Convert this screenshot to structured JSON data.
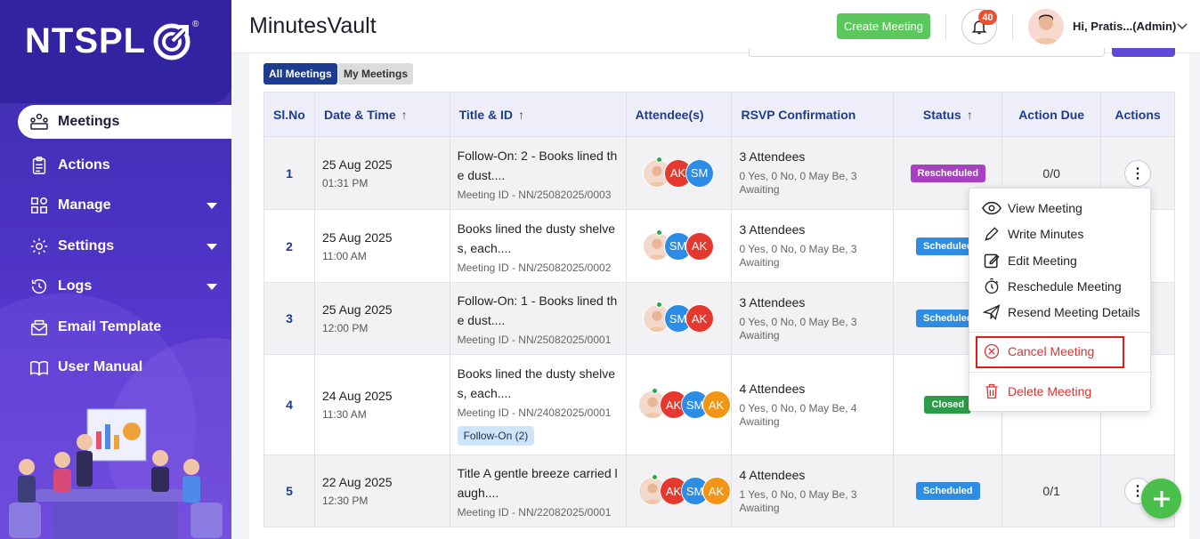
{
  "brand": {
    "logo_text": "NTSPL",
    "reg": "®"
  },
  "sidebar": {
    "items": [
      {
        "label": "Meetings",
        "icon": "meetings-icon",
        "active": true,
        "has_caret": false
      },
      {
        "label": "Actions",
        "icon": "clipboard-icon",
        "has_caret": false
      },
      {
        "label": "Manage",
        "icon": "grid-icon",
        "has_caret": true
      },
      {
        "label": "Settings",
        "icon": "gear-icon",
        "has_caret": true
      },
      {
        "label": "Logs",
        "icon": "history-icon",
        "has_caret": true
      },
      {
        "label": "Email Template",
        "icon": "email-icon",
        "has_caret": false
      },
      {
        "label": "User Manual",
        "icon": "book-icon",
        "has_caret": false
      }
    ]
  },
  "header": {
    "title": "MinutesVault",
    "create_label": "Create Meeting",
    "notification_count": "40",
    "user_label": "Hi, Pratis...(Admin)"
  },
  "tabs": {
    "all": "All Meetings",
    "my": "My Meetings"
  },
  "table": {
    "headers": {
      "sl": "Sl.No",
      "date": "Date & Time",
      "title": "Title & ID",
      "attendees": "Attendee(s)",
      "rsvp": "RSVP Confirmation",
      "status": "Status",
      "due": "Action Due",
      "actions": "Actions"
    },
    "rows": [
      {
        "sl": "1",
        "date": "25 Aug 2025",
        "time": "01:31 PM",
        "title": "Follow-On: 2 - Books lined the dust....",
        "id": "Meeting ID - NN/25082025/0003",
        "followon": "",
        "avatars": [
          "AK",
          "SM"
        ],
        "rsvp_main": "3 Attendees",
        "rsvp_sub": "0 Yes, 0 No, 0 May Be, 3 Awaiting",
        "status": "Rescheduled",
        "due": "0/0"
      },
      {
        "sl": "2",
        "date": "25 Aug 2025",
        "time": "11:00 AM",
        "title": "Books lined the dusty shelves, each....",
        "id": "Meeting ID - NN/25082025/0002",
        "followon": "",
        "avatars": [
          "SM",
          "AK"
        ],
        "rsvp_main": "3 Attendees",
        "rsvp_sub": "0 Yes, 0 No, 0 May Be, 3 Awaiting",
        "status": "Scheduled",
        "due": ""
      },
      {
        "sl": "3",
        "date": "25 Aug 2025",
        "time": "12:00 PM",
        "title": "Follow-On: 1 - Books lined the dust....",
        "id": "Meeting ID - NN/25082025/0001",
        "followon": "",
        "avatars": [
          "SM",
          "AK"
        ],
        "rsvp_main": "3 Attendees",
        "rsvp_sub": "0 Yes, 0 No, 0 May Be, 3 Awaiting",
        "status": "Scheduled",
        "due": ""
      },
      {
        "sl": "4",
        "date": "24 Aug 2025",
        "time": "11:30 AM",
        "title": "Books lined the dusty shelves, each....",
        "id": "Meeting ID - NN/24082025/0001",
        "followon": "Follow-On (2)",
        "avatars": [
          "AK",
          "SM",
          "AK"
        ],
        "rsvp_main": "4 Attendees",
        "rsvp_sub": "0 Yes, 0 No, 0 May Be, 4 Awaiting",
        "status": "Closed",
        "due": ""
      },
      {
        "sl": "5",
        "date": "22 Aug 2025",
        "time": "12:30 PM",
        "title": "Title A gentle breeze carried laugh....",
        "id": "Meeting ID - NN/22082025/0001",
        "followon": "",
        "avatars": [
          "AK",
          "SM",
          "AK"
        ],
        "rsvp_main": "4 Attendees",
        "rsvp_sub": "1 Yes, 0 No, 0 May Be, 3 Awaiting",
        "status": "Scheduled",
        "due": "0/1"
      }
    ]
  },
  "menu": {
    "view": "View Meeting",
    "write": "Write Minutes",
    "edit": "Edit Meeting",
    "reschedule": "Reschedule Meeting",
    "resend": "Resend Meeting Details",
    "cancel": "Cancel Meeting",
    "delete": "Delete Meeting"
  },
  "colors": {
    "accent": "#1d3c8f",
    "sidebar": "#4a32c2",
    "create": "#5cc75c",
    "danger": "#e03232"
  }
}
